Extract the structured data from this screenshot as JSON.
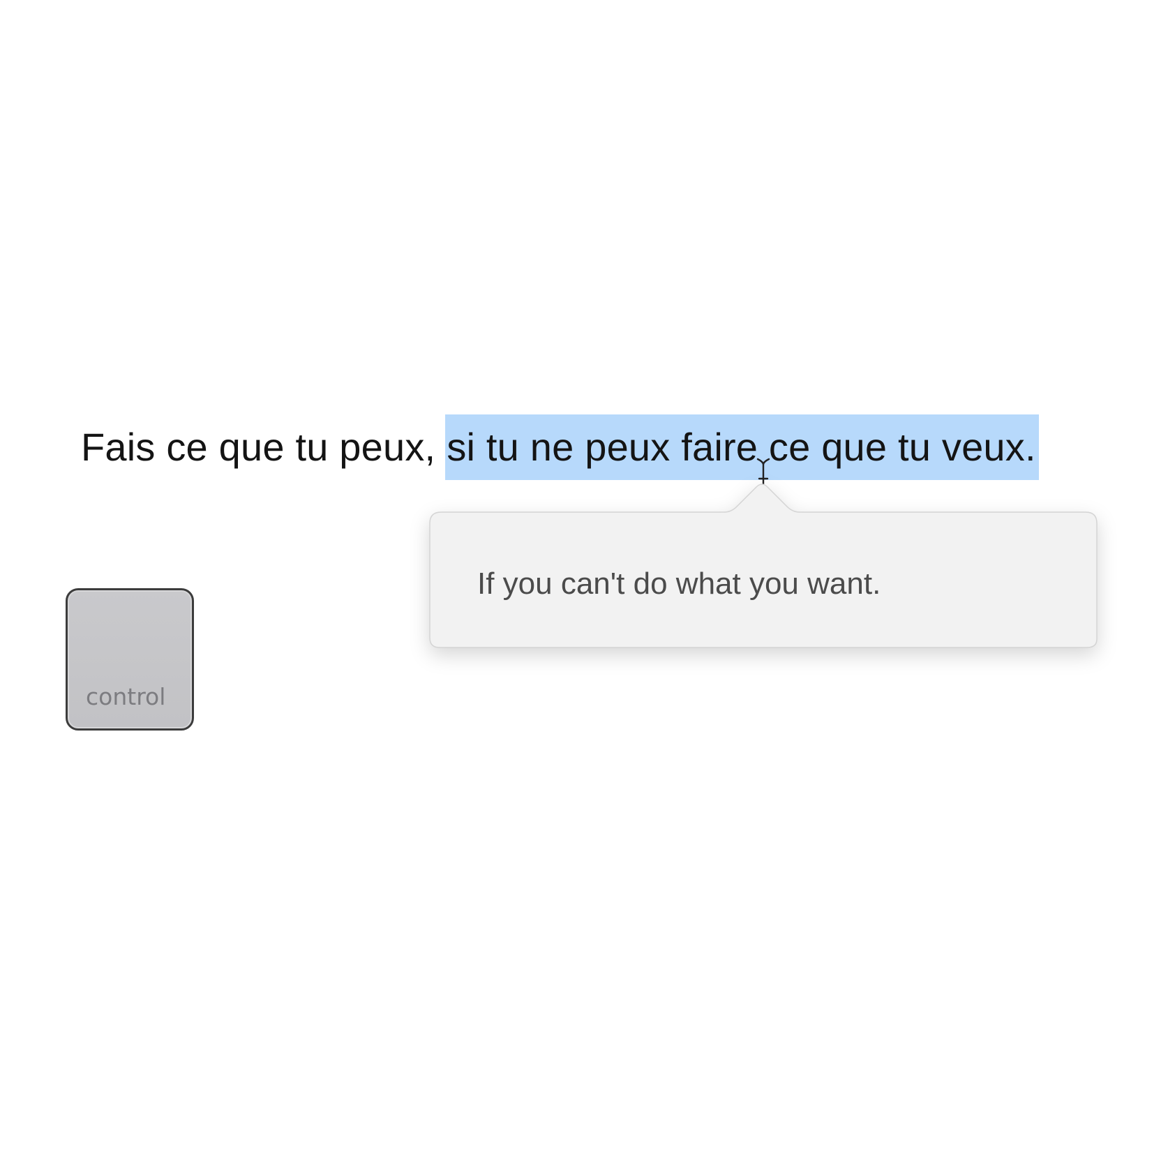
{
  "document": {
    "sentence_start": "Fais ce que tu peux,",
    "sentence_selected": "si tu ne peux faire ce que tu veux."
  },
  "translation_popover": {
    "text": "If you can't do what you want."
  },
  "modifier_key": {
    "label": "control"
  },
  "colors": {
    "selection_highlight": "#b7d9fb",
    "popover_background": "#f2f2f2",
    "key_background": "#c6c6c8"
  },
  "icons": {
    "cursor": "text-ibeam-cursor"
  }
}
